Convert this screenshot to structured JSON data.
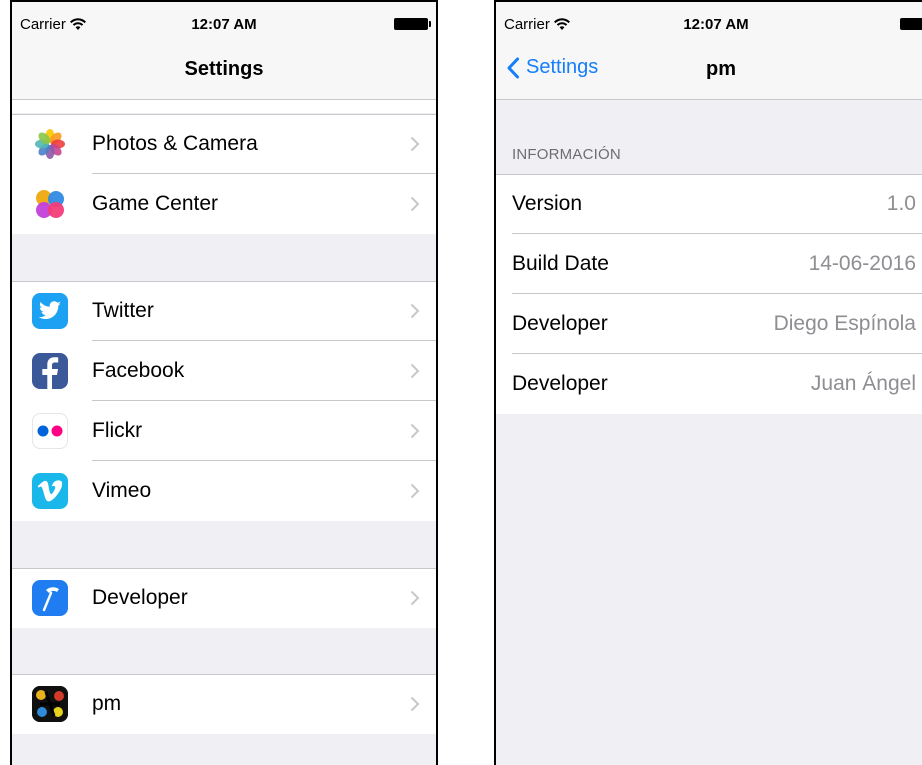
{
  "left": {
    "status": {
      "carrier": "Carrier",
      "time": "12:07 AM"
    },
    "nav": {
      "title": "Settings"
    },
    "groups": [
      {
        "items": [
          {
            "label": "Photos & Camera",
            "icon": "photos-icon"
          },
          {
            "label": "Game Center",
            "icon": "game-center-icon"
          }
        ]
      },
      {
        "items": [
          {
            "label": "Twitter",
            "icon": "twitter-icon"
          },
          {
            "label": "Facebook",
            "icon": "facebook-icon"
          },
          {
            "label": "Flickr",
            "icon": "flickr-icon"
          },
          {
            "label": "Vimeo",
            "icon": "vimeo-icon"
          }
        ]
      },
      {
        "items": [
          {
            "label": "Developer",
            "icon": "developer-hammer-icon"
          }
        ]
      },
      {
        "items": [
          {
            "label": "pm",
            "icon": "pm-app-icon"
          }
        ]
      }
    ]
  },
  "right": {
    "status": {
      "carrier": "Carrier",
      "time": "12:07 AM"
    },
    "nav": {
      "back_label": "Settings",
      "title": "pm"
    },
    "section_header": "INFORMACIÓN",
    "rows": [
      {
        "key": "Version",
        "value": "1.0"
      },
      {
        "key": "Build Date",
        "value": "14-06-2016"
      },
      {
        "key": "Developer",
        "value": "Diego Espínola"
      },
      {
        "key": "Developer",
        "value": "Juan Ángel"
      }
    ]
  },
  "colors": {
    "ios_blue": "#147efb",
    "group_bg": "#efeff4",
    "separator": "#c8c7cc",
    "value_gray": "#8e8e93",
    "twitter": "#1da1f2",
    "facebook": "#3b5998",
    "vimeo": "#1ab7ea",
    "flickr_blue": "#0063dc",
    "flickr_pink": "#ff0084"
  }
}
